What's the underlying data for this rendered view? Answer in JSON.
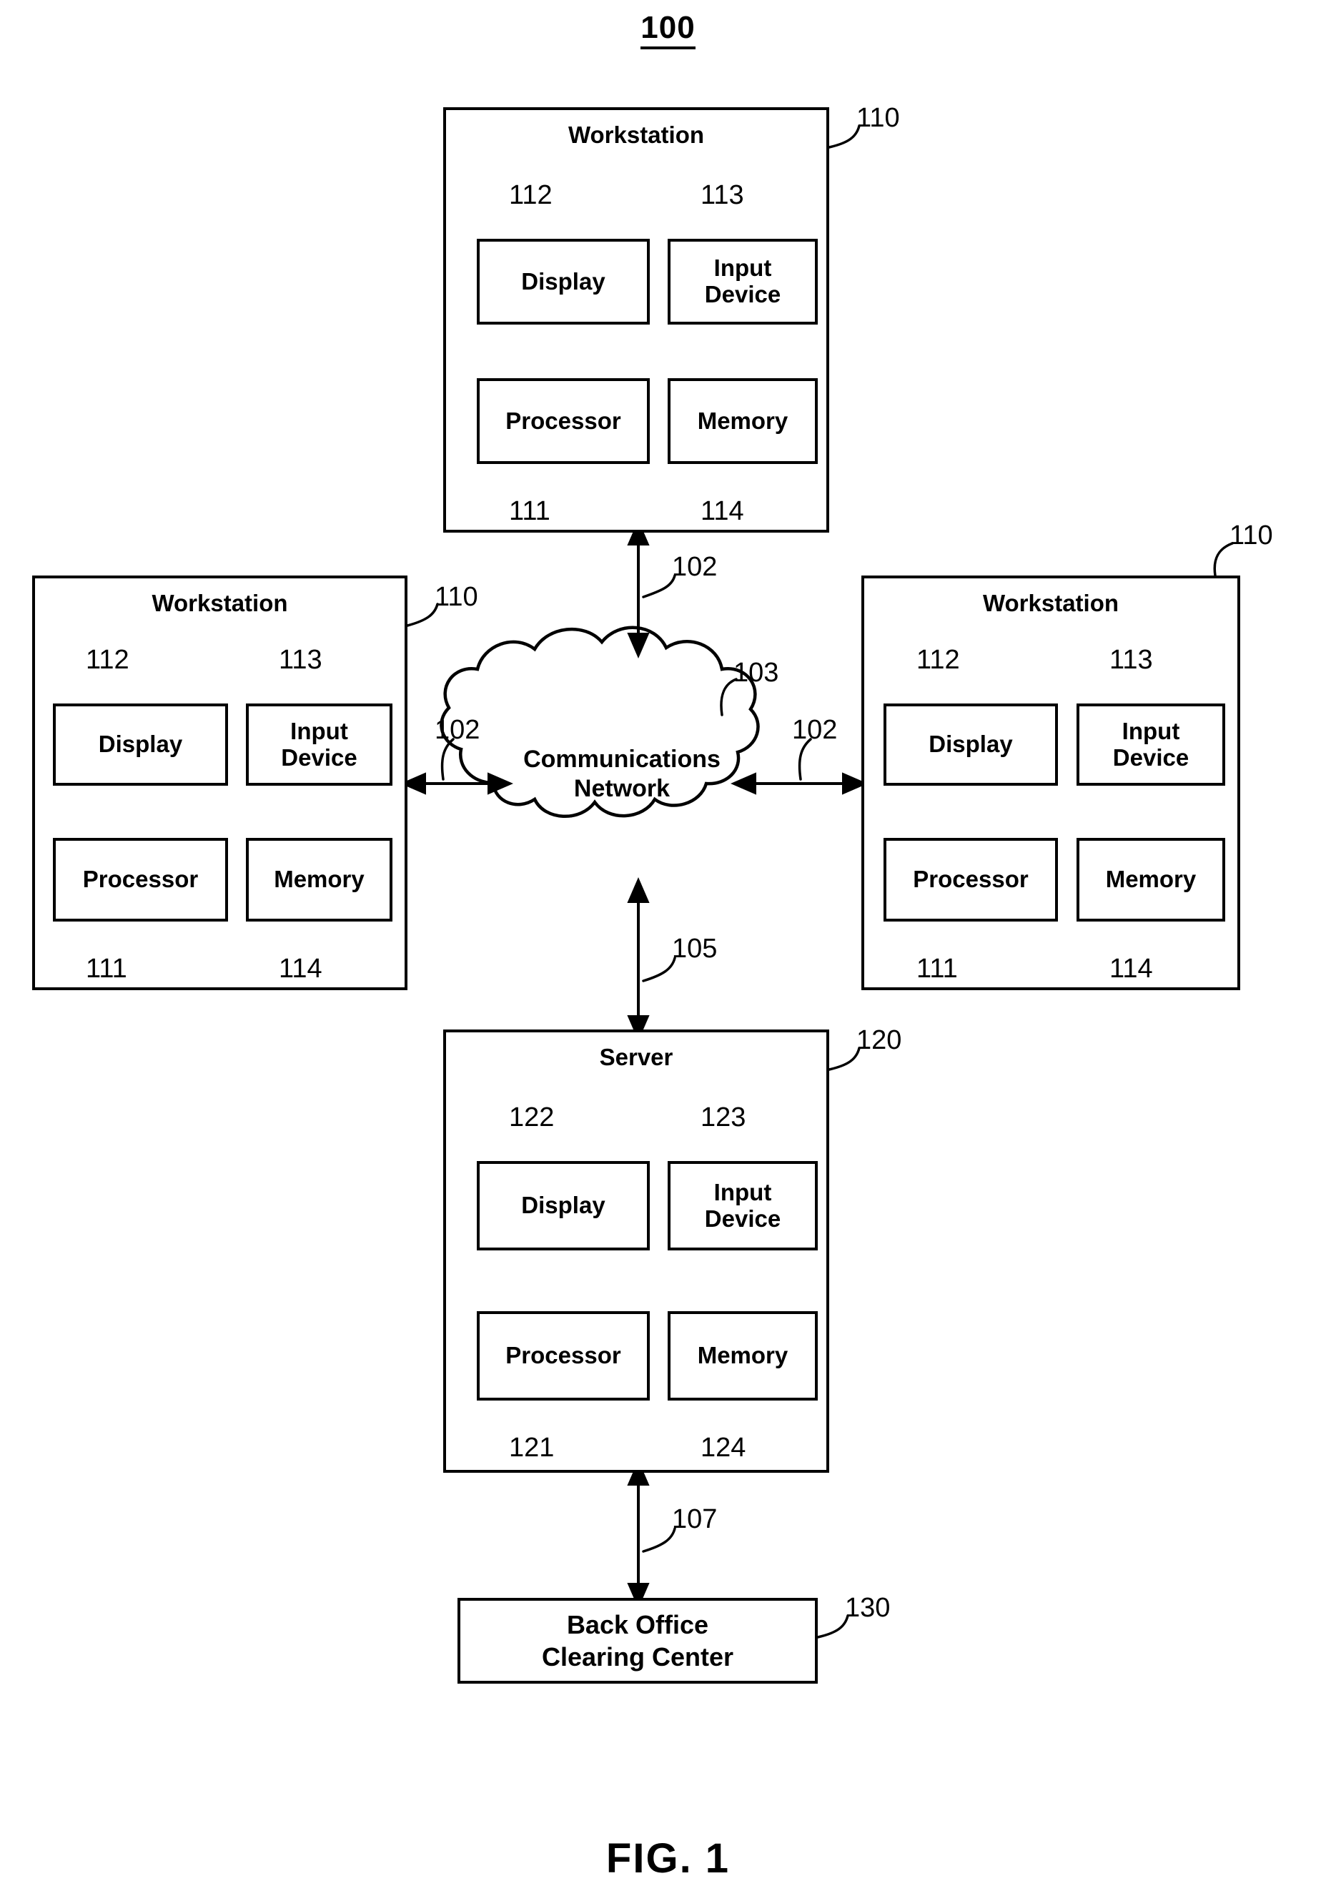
{
  "figure": {
    "system_number": "100",
    "caption": "FIG. 1"
  },
  "cloud": {
    "label_line1": "Communications",
    "label_line2": "Network",
    "ref": "103"
  },
  "links": [
    {
      "id": "link-top",
      "ref": "102"
    },
    {
      "id": "link-left",
      "ref": "102"
    },
    {
      "id": "link-right",
      "ref": "102"
    },
    {
      "id": "link-bottom",
      "ref": "105"
    },
    {
      "id": "link-backoffice",
      "ref": "107"
    }
  ],
  "workstations": [
    {
      "id": "workstation-top",
      "title": "Workstation",
      "ref": "110",
      "components": [
        {
          "name": "display",
          "label": "Display",
          "ref": "112"
        },
        {
          "name": "input-device",
          "label": "Input\nDevice",
          "ref": "113"
        },
        {
          "name": "processor",
          "label": "Processor",
          "ref": "111"
        },
        {
          "name": "memory",
          "label": "Memory",
          "ref": "114"
        }
      ]
    },
    {
      "id": "workstation-left",
      "title": "Workstation",
      "ref": "110",
      "components": [
        {
          "name": "display",
          "label": "Display",
          "ref": "112"
        },
        {
          "name": "input-device",
          "label": "Input\nDevice",
          "ref": "113"
        },
        {
          "name": "processor",
          "label": "Processor",
          "ref": "111"
        },
        {
          "name": "memory",
          "label": "Memory",
          "ref": "114"
        }
      ]
    },
    {
      "id": "workstation-right",
      "title": "Workstation",
      "ref": "110",
      "components": [
        {
          "name": "display",
          "label": "Display",
          "ref": "112"
        },
        {
          "name": "input-device",
          "label": "Input\nDevice",
          "ref": "113"
        },
        {
          "name": "processor",
          "label": "Processor",
          "ref": "111"
        },
        {
          "name": "memory",
          "label": "Memory",
          "ref": "114"
        }
      ]
    }
  ],
  "server": {
    "id": "server",
    "title": "Server",
    "ref": "120",
    "components": [
      {
        "name": "display",
        "label": "Display",
        "ref": "122"
      },
      {
        "name": "input-device",
        "label": "Input\nDevice",
        "ref": "123"
      },
      {
        "name": "processor",
        "label": "Processor",
        "ref": "121"
      },
      {
        "name": "memory",
        "label": "Memory",
        "ref": "124"
      }
    ]
  },
  "back_office": {
    "id": "back-office-clearing-center",
    "label_line1": "Back Office",
    "label_line2": "Clearing Center",
    "ref": "130"
  },
  "colors": {
    "stroke": "#000000",
    "background": "#ffffff"
  }
}
